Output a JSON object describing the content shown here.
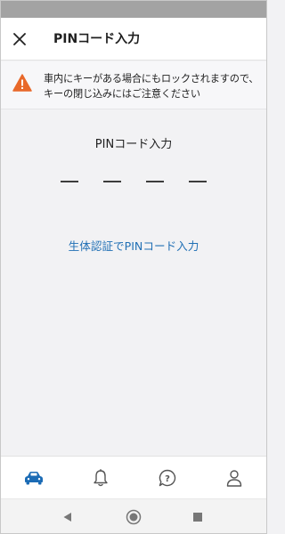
{
  "header": {
    "title": "PINコード入力",
    "close_icon": "close-icon"
  },
  "warning": {
    "icon": "warning-icon",
    "text": "車内にキーがある場合にもロックされますので、キーの閉じ込みにはご注意ください",
    "icon_color": "#e8692a"
  },
  "pin": {
    "label": "PINコード入力",
    "slot_count": 4,
    "entered_digits": 0
  },
  "biometric_link": "生体認証でPINコード入力",
  "tabbar": {
    "items": [
      {
        "name": "car-icon",
        "active": true
      },
      {
        "name": "bell-icon",
        "active": false
      },
      {
        "name": "help-icon",
        "active": false
      },
      {
        "name": "person-icon",
        "active": false
      }
    ],
    "active_color": "#1b6bb5",
    "inactive_color": "#555555"
  },
  "system_nav": {
    "items": [
      "back-icon",
      "home-icon",
      "recents-icon"
    ]
  }
}
